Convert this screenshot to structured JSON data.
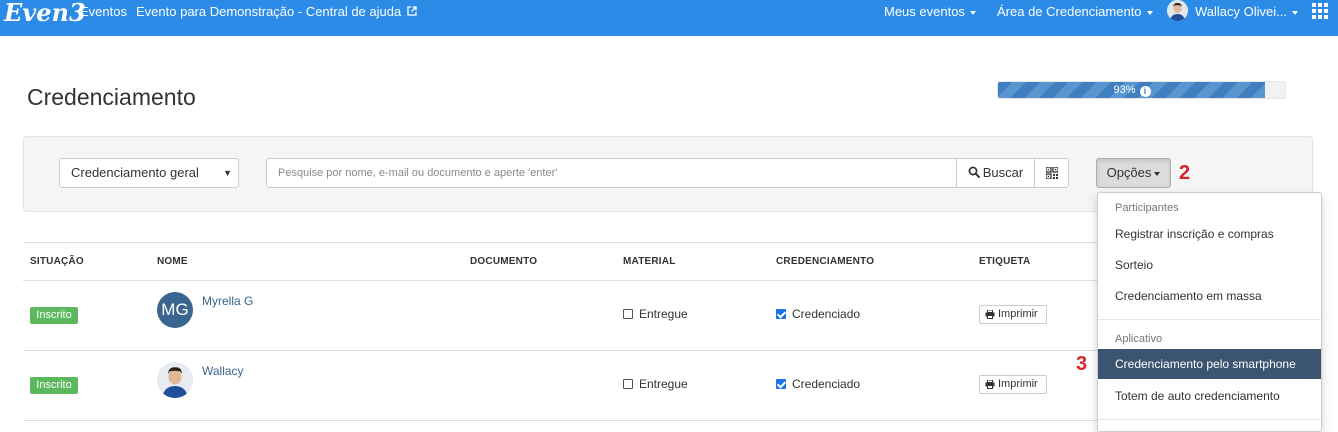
{
  "header": {
    "logo": "Even3",
    "nav_eventos": "Eventos",
    "event_link": "Evento para Demonstração - Central de ajuda",
    "meus_eventos": "Meus eventos",
    "area": "Área de Credenciamento",
    "user": "Wallacy Olivei..."
  },
  "page": {
    "title": "Credenciamento",
    "progress_label": "93%",
    "progress_value": 0.93
  },
  "filters": {
    "select_value": "Credenciamento geral",
    "search_placeholder": "Pesquise por nome, e-mail ou documento e aperte 'enter'",
    "buscar_label": "Buscar",
    "opcoes_label": "Opções"
  },
  "annotations": {
    "step2": "2",
    "step3": "3"
  },
  "table": {
    "columns": [
      "SITUAÇÃO",
      "NOME",
      "DOCUMENTO",
      "MATERIAL",
      "CREDENCIAMENTO",
      "ETIQUETA"
    ],
    "rows": [
      {
        "status": "Inscrito",
        "initials": "MG",
        "name": "Myrella G",
        "document": "",
        "material_label": "Entregue",
        "material_checked": false,
        "cred_label": "Credenciado",
        "cred_checked": true,
        "print_label": "Imprimir"
      },
      {
        "status": "Inscrito",
        "initials": "",
        "name": "Wallacy",
        "document": "",
        "material_label": "Entregue",
        "material_checked": false,
        "cred_label": "Credenciado",
        "cred_checked": true,
        "print_label": "Imprimir"
      }
    ]
  },
  "dropdown": {
    "section1": "Participantes",
    "items1": [
      "Registrar inscrição e compras",
      "Sorteio",
      "Credenciamento em massa"
    ],
    "section2": "Aplicativo",
    "items2": [
      "Credenciamento pelo smartphone",
      "Totem de auto credenciamento"
    ]
  },
  "colors": {
    "topbar": "#2b8be6",
    "badge": "#5cb85c",
    "active_item": "#3b5470",
    "annotation": "#d9232e"
  }
}
